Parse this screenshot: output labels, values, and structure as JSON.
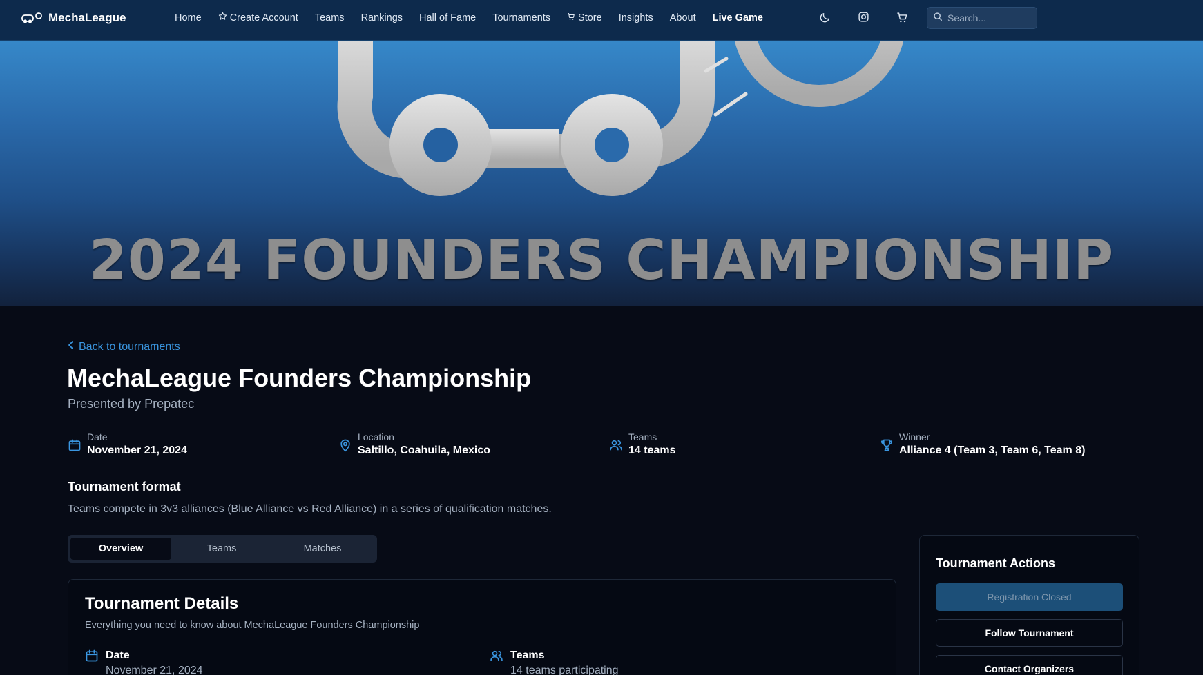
{
  "brand": {
    "name": "MechaLeague"
  },
  "nav": {
    "items": [
      {
        "label": "Home"
      },
      {
        "label": "Create Account"
      },
      {
        "label": "Teams"
      },
      {
        "label": "Rankings"
      },
      {
        "label": "Hall of Fame"
      },
      {
        "label": "Tournaments"
      },
      {
        "label": "Store"
      },
      {
        "label": "Insights"
      },
      {
        "label": "About"
      },
      {
        "label": "Live Game"
      }
    ]
  },
  "search": {
    "placeholder": "Search..."
  },
  "hero": {
    "title": "2024 FOUNDERS CHAMPIONSHIP"
  },
  "back_link": "Back to tournaments",
  "tournament": {
    "title": "MechaLeague Founders Championship",
    "presented_by": "Presented by Prepatec",
    "info": {
      "date": {
        "label": "Date",
        "value": "November 21, 2024"
      },
      "location": {
        "label": "Location",
        "value": "Saltillo, Coahuila, Mexico"
      },
      "teams": {
        "label": "Teams",
        "value": "14 teams"
      },
      "winner": {
        "label": "Winner",
        "value": "Alliance 4 (Team 3, Team 6, Team 8)"
      }
    },
    "format": {
      "title": "Tournament format",
      "description": "Teams compete in 3v3 alliances (Blue Alliance vs Red Alliance) in a series of qualification matches."
    }
  },
  "tabs": [
    {
      "label": "Overview",
      "active": true
    },
    {
      "label": "Teams",
      "active": false
    },
    {
      "label": "Matches",
      "active": false
    }
  ],
  "details": {
    "title": "Tournament Details",
    "subtitle": "Everything you need to know about MechaLeague Founders Championship",
    "date": {
      "label": "Date",
      "value": "November 21, 2024"
    },
    "teams": {
      "label": "Teams",
      "value": "14 teams participating"
    }
  },
  "actions": {
    "title": "Tournament Actions",
    "registration": "Registration Closed",
    "follow": "Follow Tournament",
    "contact": "Contact Organizers"
  },
  "colors": {
    "nav_bg": "#0d2a4c",
    "page_bg": "#070b16",
    "accent": "#3a96e0",
    "disabled_button": "#1c4f78"
  },
  "icons": [
    "logo-icon",
    "star-icon",
    "cart-icon",
    "moon-icon",
    "instagram-icon",
    "shopping-cart-icon",
    "search-icon",
    "chevron-left-icon",
    "calendar-icon",
    "map-pin-icon",
    "users-icon",
    "trophy-icon"
  ]
}
